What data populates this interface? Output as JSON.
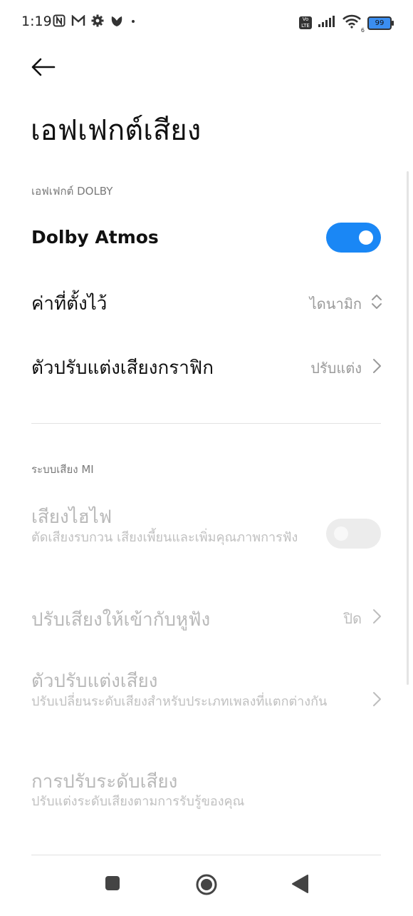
{
  "status_bar": {
    "time": "1:19",
    "left_icons": [
      "nfc-icon",
      "gmail-icon",
      "settings-gear-icon",
      "app-leaf-icon",
      "dot-icon"
    ],
    "volte": "Vo LTE",
    "wifi_sub": "6",
    "battery": "99"
  },
  "header": {
    "title": "เอฟเฟกต์เสียง"
  },
  "sections": {
    "dolby": {
      "header": "เอฟเฟกต์ DOLBY",
      "dolby_atmos": {
        "label": "Dolby Atmos",
        "enabled": true
      },
      "preset": {
        "label": "ค่าที่ตั้งไว้",
        "value": "ไดนามิก"
      },
      "graphic_eq": {
        "label": "ตัวปรับแต่งเสียงกราฟิก",
        "value": "ปรับแต่ง"
      }
    },
    "mi": {
      "header": "ระบบเสียง MI",
      "hifi": {
        "label": "เสียงไฮไฟ",
        "description": "ตัดเสียงรบกวน เสียงเพี้ยนและเพิ่มคุณภาพการฟัง",
        "enabled": false
      },
      "ear_adapt": {
        "label": "ปรับเสียงให้เข้ากับหูฟัง",
        "value": "ปิด"
      },
      "equalizer": {
        "label": "ตัวปรับแต่งเสียง",
        "description": "ปรับเปลี่ยนระดับเสียงสำหรับประเภทเพลงที่แตกต่างกัน"
      },
      "level": {
        "label": "การปรับระดับเสียง",
        "description": "ปรับแต่งระดับเสียงตามการรับรู้ของคุณ"
      }
    }
  },
  "colors": {
    "accent": "#1a87f5",
    "disabled_text": "#b9b9b9",
    "secondary_text": "#9a9a9a"
  }
}
